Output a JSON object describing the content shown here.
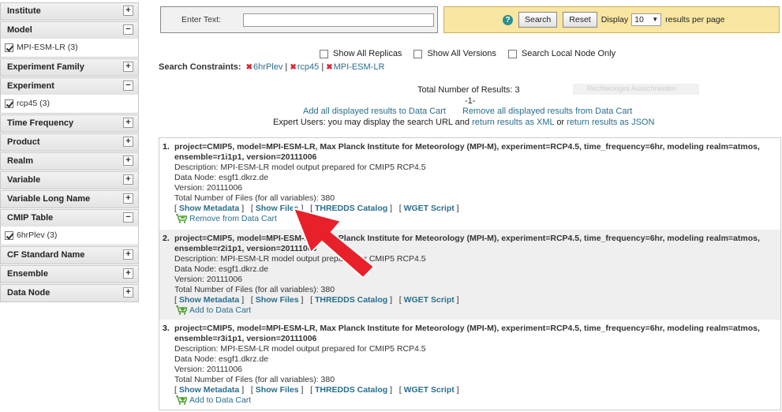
{
  "sidebar": {
    "facets": [
      {
        "name": "Institute",
        "expanded": false
      },
      {
        "name": "Model",
        "expanded": true,
        "value": "MPI-ESM-LR (3)"
      },
      {
        "name": "Experiment Family",
        "expanded": false
      },
      {
        "name": "Experiment",
        "expanded": true,
        "value": "rcp45 (3)"
      },
      {
        "name": "Time Frequency",
        "expanded": false
      },
      {
        "name": "Product",
        "expanded": false
      },
      {
        "name": "Realm",
        "expanded": false
      },
      {
        "name": "Variable",
        "expanded": false
      },
      {
        "name": "Variable Long Name",
        "expanded": false
      },
      {
        "name": "CMIP Table",
        "expanded": true,
        "value": "6hrPlev (3)"
      },
      {
        "name": "CF Standard Name",
        "expanded": false
      },
      {
        "name": "Ensemble",
        "expanded": false
      },
      {
        "name": "Data Node",
        "expanded": false
      }
    ]
  },
  "search": {
    "label": "Enter Text:",
    "value": "",
    "help": "?",
    "search_button": "Search",
    "reset_button": "Reset",
    "display_label": "Display",
    "per_page": "10",
    "per_page_suffix": "results per page"
  },
  "options": {
    "replicas": "Show All Replicas",
    "versions": "Show All Versions",
    "local": "Search Local Node Only"
  },
  "constraints": {
    "title": "Search Constraints:",
    "items": [
      "6hrPlev",
      "rcp45",
      "MPI-ESM-LR"
    ],
    "separator": "|"
  },
  "summary": {
    "total": "Total Number of Results: 3",
    "page": "-1-",
    "add_all": "Add all displayed results to Data Cart",
    "remove_all": "Remove all displayed results from Data Cart",
    "expert_prefix": "Expert Users: you may display the search URL and",
    "xml_link": "return results as XML",
    "or": "or",
    "json_link": "return results as JSON",
    "ghost_text": "Rechteckiges Ausschneiden"
  },
  "results": [
    {
      "num": "1.",
      "head": "project=CMIP5, model=MPI-ESM-LR, Max Planck Institute for Meteorology (MPI-M), experiment=RCP4.5, time_frequency=6hr, modeling realm=atmos, ensemble=r1i1p1, version=20111006",
      "description": "Description: MPI-ESM-LR model output prepared for CMIP5 RCP4.5",
      "node": "Data Node: esgf1.dkrz.de",
      "version": "Version: 20111006",
      "files": "Total Number of Files (for all variables): 380",
      "links": [
        "Show Metadata",
        "Show Files",
        "THREDDS Catalog",
        "WGET Script"
      ],
      "cart": "Remove from Data Cart"
    },
    {
      "num": "2.",
      "head": "project=CMIP5, model=MPI-ESM-LR, Max Planck Institute for Meteorology (MPI-M), experiment=RCP4.5, time_frequency=6hr, modeling realm=atmos, ensemble=r2i1p1, version=20111006",
      "description": "Description: MPI-ESM-LR model output prepared for CMIP5 RCP4.5",
      "node": "Data Node: esgf1.dkrz.de",
      "version": "Version: 20111006",
      "files": "Total Number of Files (for all variables): 380",
      "links": [
        "Show Metadata",
        "Show Files",
        "THREDDS Catalog",
        "WGET Script"
      ],
      "cart": "Add to Data Cart"
    },
    {
      "num": "3.",
      "head": "project=CMIP5, model=MPI-ESM-LR, Max Planck Institute for Meteorology (MPI-M), experiment=RCP4.5, time_frequency=6hr, modeling realm=atmos, ensemble=r3i1p1, version=20111006",
      "description": "Description: MPI-ESM-LR model output prepared for CMIP5 RCP4.5",
      "node": "Data Node: esgf1.dkrz.de",
      "version": "Version: 20111006",
      "files": "Total Number of Files (for all variables): 380",
      "links": [
        "Show Metadata",
        "Show Files",
        "THREDDS Catalog",
        "WGET Script"
      ],
      "cart": "Add to Data Cart"
    }
  ],
  "colors": {
    "link": "#2a6e8c",
    "action_bar": "#f8e6a2",
    "arrow": "#e8202a",
    "cart_icon": "#4a9a2a"
  }
}
